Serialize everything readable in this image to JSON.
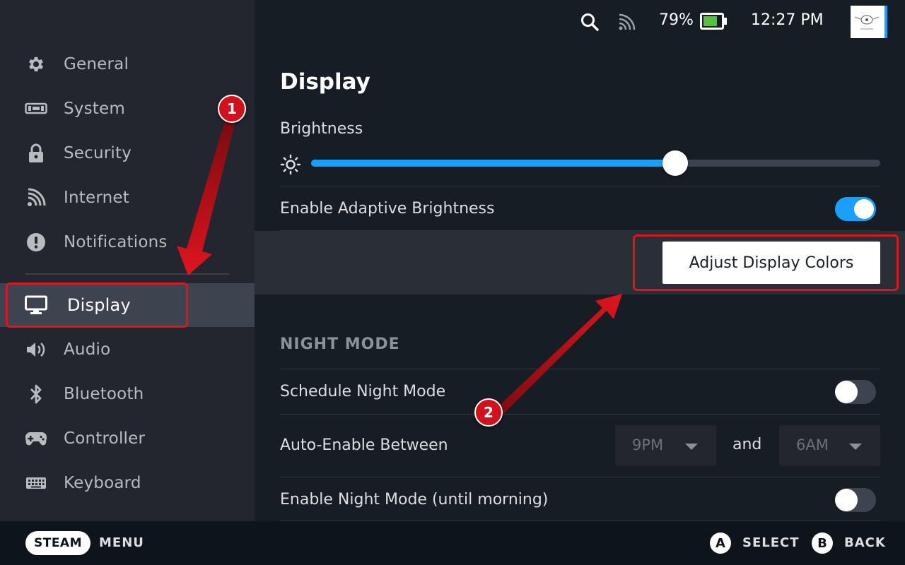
{
  "topbar": {
    "battery_percent_label": "79%",
    "battery_level": 0.79,
    "time": "12:27 PM",
    "icons": [
      "search-icon",
      "signal-icon",
      "battery-icon"
    ]
  },
  "sidebar": {
    "items": [
      {
        "label": "General",
        "icon": "gear-icon"
      },
      {
        "label": "System",
        "icon": "system-icon"
      },
      {
        "label": "Security",
        "icon": "lock-icon"
      },
      {
        "label": "Internet",
        "icon": "wifi-icon"
      },
      {
        "label": "Notifications",
        "icon": "alert-icon"
      },
      {
        "label": "Display",
        "icon": "monitor-icon",
        "active": true
      },
      {
        "label": "Audio",
        "icon": "speaker-icon"
      },
      {
        "label": "Bluetooth",
        "icon": "bluetooth-icon"
      },
      {
        "label": "Controller",
        "icon": "gamepad-icon"
      },
      {
        "label": "Keyboard",
        "icon": "keyboard-icon"
      }
    ]
  },
  "display": {
    "title": "Display",
    "brightness_label": "Brightness",
    "brightness_level": 0.64,
    "adaptive_label": "Enable Adaptive Brightness",
    "adaptive_on": true,
    "adjust_colors_button": "Adjust Display Colors"
  },
  "night_mode": {
    "section_title": "NIGHT MODE",
    "schedule_label": "Schedule Night Mode",
    "schedule_on": false,
    "auto_enable_label": "Auto-Enable Between",
    "start_value": "9PM",
    "and_label": "and",
    "end_value": "6AM",
    "enable_until_label": "Enable Night Mode (until morning)",
    "enable_until_on": false
  },
  "footer": {
    "steam_label": "STEAM",
    "menu_label": "MENU",
    "a_glyph": "A",
    "select_label": "SELECT",
    "b_glyph": "B",
    "back_label": "BACK"
  },
  "annotations": {
    "badge1": "1",
    "badge2": "2",
    "color": "#e0141e"
  },
  "colors": {
    "accent": "#1a9fff",
    "sidebar_bg": "#23262e",
    "main_bg": "#171d25",
    "active_item_bg": "#3d4450"
  }
}
